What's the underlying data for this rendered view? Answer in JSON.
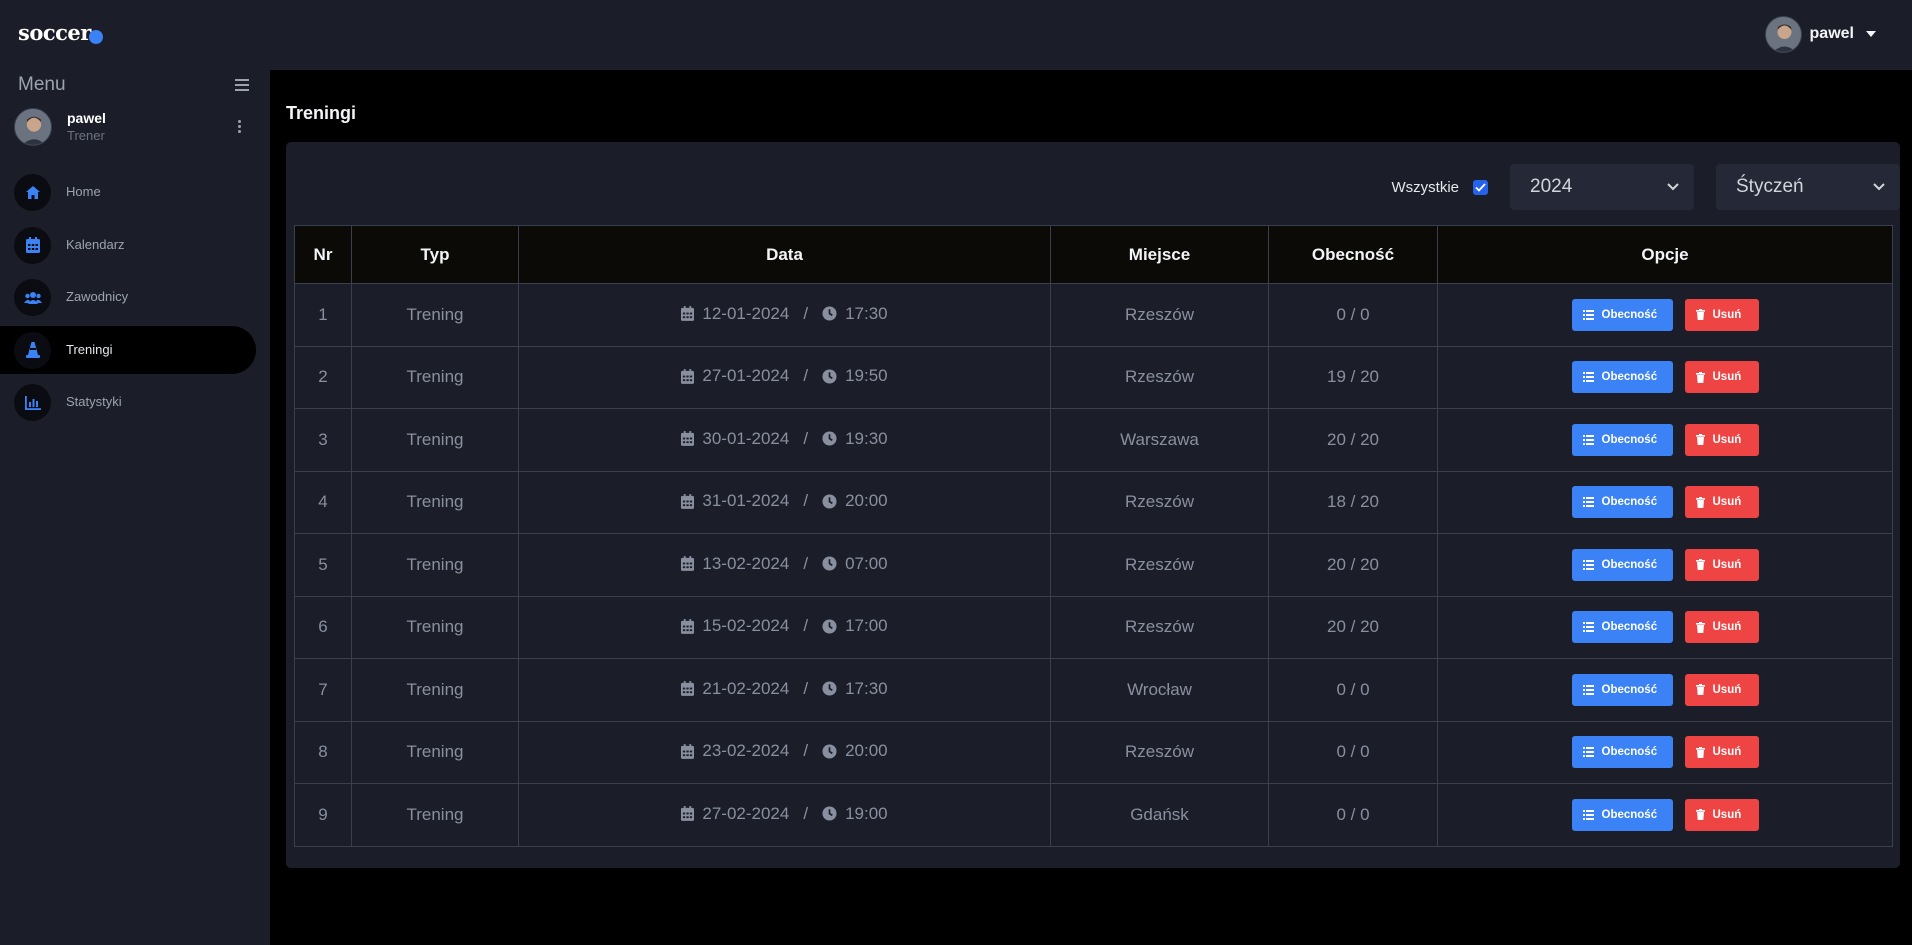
{
  "app": {
    "logo": "soccer"
  },
  "header": {
    "username": "pawel"
  },
  "sidebar": {
    "menu_title": "Menu",
    "user": {
      "name": "pawel",
      "role": "Trener"
    },
    "items": [
      {
        "label": "Home",
        "icon": "home-icon"
      },
      {
        "label": "Kalendarz",
        "icon": "calendar-icon"
      },
      {
        "label": "Zawodnicy",
        "icon": "users-icon"
      },
      {
        "label": "Treningi",
        "icon": "cone-icon",
        "active": true
      },
      {
        "label": "Statystyki",
        "icon": "chart-icon"
      }
    ]
  },
  "page": {
    "title": "Treningi"
  },
  "filters": {
    "all_label": "Wszystkie",
    "all_checked": true,
    "year": "2024",
    "month": "Śtyczeń"
  },
  "table": {
    "columns": [
      "Nr",
      "Typ",
      "Data",
      "Miejsce",
      "Obecność",
      "Opcje"
    ],
    "rows": [
      {
        "nr": "1",
        "typ": "Trening",
        "date": "12-01-2024",
        "time": "17:30",
        "place": "Rzeszów",
        "attendance": "0 / 0"
      },
      {
        "nr": "2",
        "typ": "Trening",
        "date": "27-01-2024",
        "time": "19:50",
        "place": "Rzeszów",
        "attendance": "19 / 20"
      },
      {
        "nr": "3",
        "typ": "Trening",
        "date": "30-01-2024",
        "time": "19:30",
        "place": "Warszawa",
        "attendance": "20 / 20"
      },
      {
        "nr": "4",
        "typ": "Trening",
        "date": "31-01-2024",
        "time": "20:00",
        "place": "Rzeszów",
        "attendance": "18 / 20"
      },
      {
        "nr": "5",
        "typ": "Trening",
        "date": "13-02-2024",
        "time": "07:00",
        "place": "Rzeszów",
        "attendance": "20 / 20"
      },
      {
        "nr": "6",
        "typ": "Trening",
        "date": "15-02-2024",
        "time": "17:00",
        "place": "Rzeszów",
        "attendance": "20 / 20"
      },
      {
        "nr": "7",
        "typ": "Trening",
        "date": "21-02-2024",
        "time": "17:30",
        "place": "Wrocław",
        "attendance": "0 / 0"
      },
      {
        "nr": "8",
        "typ": "Trening",
        "date": "23-02-2024",
        "time": "20:00",
        "place": "Rzeszów",
        "attendance": "0 / 0"
      },
      {
        "nr": "9",
        "typ": "Trening",
        "date": "27-02-2024",
        "time": "19:00",
        "place": "Gdańsk",
        "attendance": "0 / 0"
      }
    ],
    "buttons": {
      "attendance": "Obecność",
      "delete": "Usuń"
    },
    "date_separator": "/"
  },
  "colors": {
    "accent": "#3b82f6",
    "danger": "#ef4444",
    "panel": "#1b1e29",
    "background": "#000000"
  }
}
